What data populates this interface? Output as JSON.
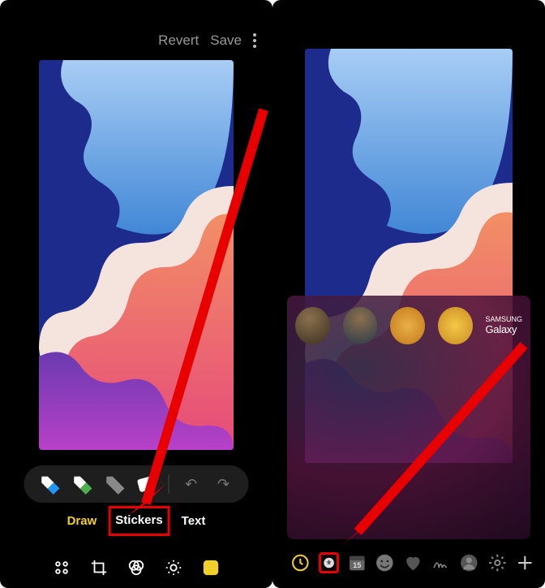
{
  "left": {
    "top_bar": {
      "revert_label": "Revert",
      "save_label": "Save"
    },
    "tools": {
      "blue_pen": "blue-pen",
      "green_pen": "green-pen",
      "grey_pen": "grey-pen",
      "eraser": "eraser",
      "undo": "undo",
      "redo": "redo"
    },
    "mode_tabs": {
      "draw": "Draw",
      "stickers": "Stickers",
      "text": "Text"
    },
    "bottom_icons": [
      "apps",
      "crop",
      "filters",
      "adjust",
      "decorate"
    ]
  },
  "right": {
    "brand": {
      "small": "SAMSUNG",
      "big": "Galaxy"
    },
    "categories": [
      "recent",
      "gallery",
      "calendar",
      "emoji",
      "heart",
      "signature",
      "avatar",
      "settings",
      "add"
    ],
    "calendar_day": "15"
  }
}
